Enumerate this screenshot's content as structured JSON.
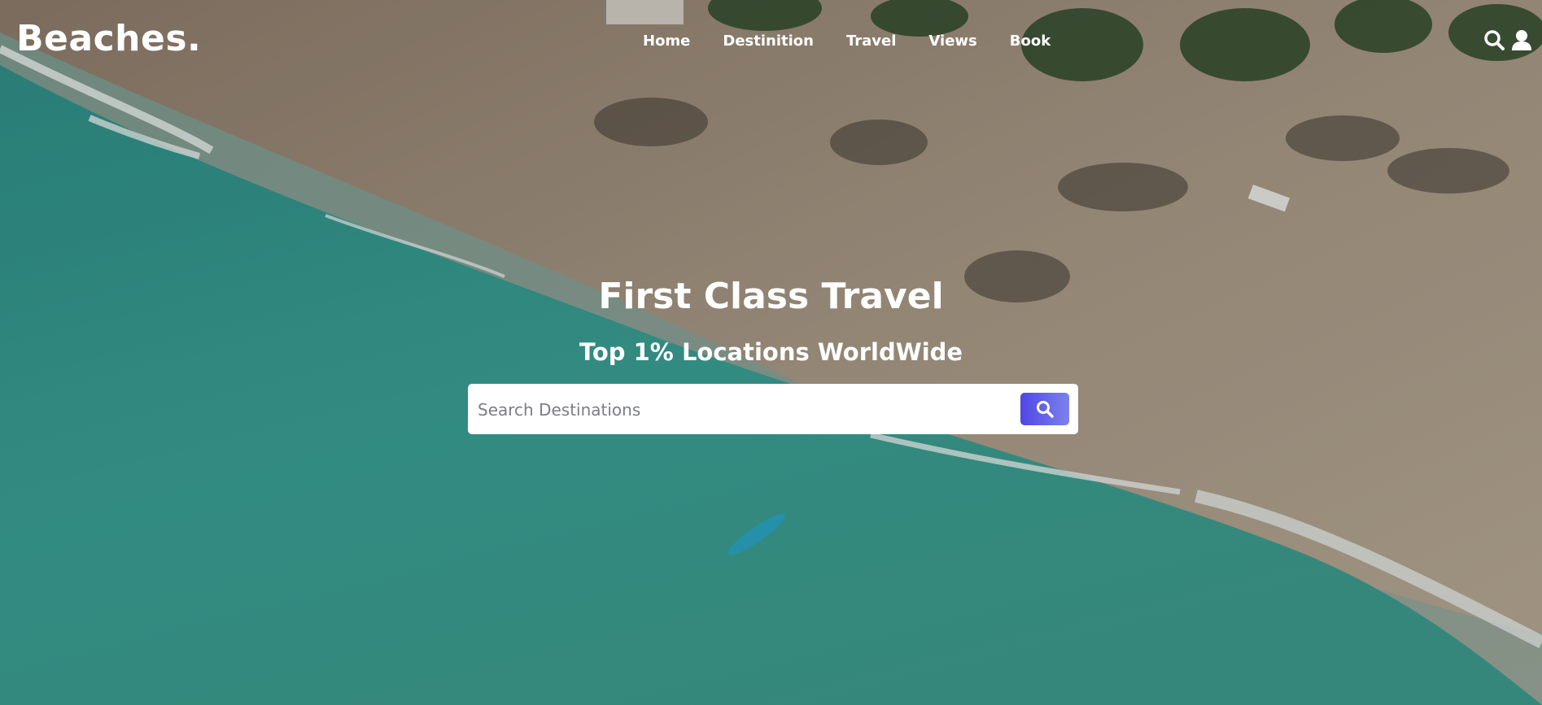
{
  "brand": {
    "logo_text": "Beaches."
  },
  "nav": {
    "items": [
      {
        "label": "Home"
      },
      {
        "label": "Destinition"
      },
      {
        "label": "Travel"
      },
      {
        "label": "Views"
      },
      {
        "label": "Book"
      }
    ]
  },
  "header_icons": {
    "search": "search-icon",
    "user": "user-icon"
  },
  "hero": {
    "title": "First Class Travel",
    "subtitle": "Top 1% Locations WorldWide"
  },
  "search": {
    "placeholder": "Search Destinations",
    "value": "",
    "button_icon": "search-icon"
  },
  "colors": {
    "accent": "#5046e5",
    "accent_light": "#7b82ea",
    "text_on_image": "#ffffff",
    "sea": "#3a9c91",
    "sand": "#b8ab99"
  }
}
